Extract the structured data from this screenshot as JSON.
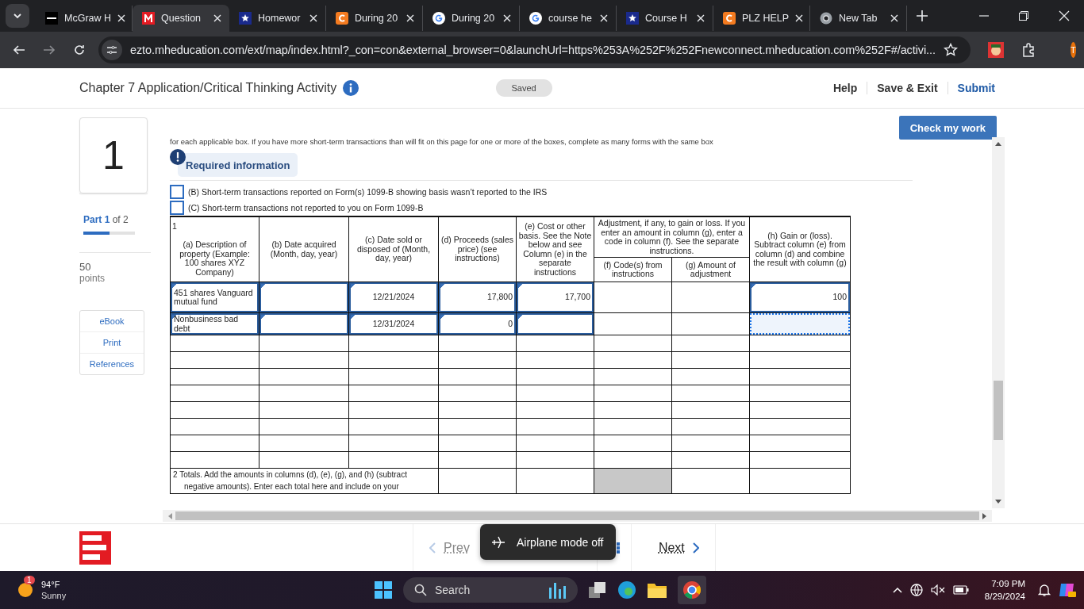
{
  "browser": {
    "tabs": [
      {
        "title": "McGraw H",
        "kind": "d2l",
        "selected": false
      },
      {
        "title": "Question",
        "kind": "mh",
        "selected": true
      },
      {
        "title": "Homewor",
        "kind": "star",
        "selected": false
      },
      {
        "title": "During 20",
        "kind": "c",
        "selected": false
      },
      {
        "title": "During 20",
        "kind": "google",
        "selected": false
      },
      {
        "title": "course he",
        "kind": "google",
        "selected": false
      },
      {
        "title": "Course H",
        "kind": "star",
        "selected": false
      },
      {
        "title": "PLZ HELP",
        "kind": "c",
        "selected": false
      },
      {
        "title": "New Tab",
        "kind": "chrome",
        "selected": false
      }
    ],
    "address": "ezto.mheducation.com/ext/map/index.html?_con=con&external_browser=0&launchUrl=https%253A%252F%252Fnewconnect.mheducation.com%252F#/activi...",
    "profile": "T"
  },
  "header": {
    "title": "Chapter 7 Application/Critical Thinking Activity",
    "status": "Saved",
    "links": [
      "Help",
      "Save & Exit",
      "Submit"
    ]
  },
  "sidebar": {
    "question_number": "1",
    "part": "**Part 1** of 2",
    "progress": {
      "level": 0.5
    },
    "points": "50",
    "points_label": "points",
    "resources": [
      "eBook",
      "Print",
      "References"
    ]
  },
  "check_button": "Check my work",
  "instructions": "for each applicable box. If you have more short-term transactions than will fit on this page for one or more of the boxes, complete as many forms with the same box",
  "required_info": "Required information",
  "checkboxes": [
    {
      "label": "(B) Short-term transactions reported on Form(s) 1099-B showing basis wasn’t reported to the IRS",
      "checked": false
    },
    {
      "label": "(C) Short-term transactions not reported to you on Form 1099-B",
      "checked": false
    }
  ],
  "table": {
    "line_number": "1",
    "columns": [
      "(a) Description of property (Example: 100 shares XYZ Company)",
      "(b) Date acquired (Month, day, year)",
      "(c) Date sold or disposed of (Month, day, year)",
      "(d) Proceeds (sales price) (see instructions)",
      "(e) Cost or other basis.  See the Note below and see Column (e) in the separate instructions",
      "(f) Code(s) from instructions",
      "(g) Amount of adjustment",
      "(h) Gain or (loss). Subtract column (e) from column (d) and combine the result with column (g)"
    ],
    "adjustment_heading": "Adjustment, if any, to gain or loss.  If you enter an amount in column (g), enter a code in column (f).  See the separate instructions.",
    "rows": [
      {
        "kind": "entry",
        "cells": [
          {
            "kind": "input",
            "value": "451 shares Vanguard mutual fund",
            "focused": false
          },
          {
            "kind": "input",
            "focused": false
          },
          {
            "kind": "input",
            "value": "12/21/2024",
            "focused": false
          },
          {
            "kind": "input",
            "value": "17,800",
            "focused": false
          },
          {
            "kind": "input",
            "value": "17,700",
            "focused": false
          },
          {
            "kind": "plain"
          },
          {
            "kind": "plain"
          },
          {
            "kind": "input",
            "value": "100",
            "focused": false
          }
        ]
      },
      {
        "kind": "entry",
        "cells": [
          {
            "kind": "input",
            "value": "Nonbusiness bad debt",
            "focused": false
          },
          {
            "kind": "input",
            "focused": false
          },
          {
            "kind": "input",
            "value": "12/31/2024",
            "focused": false
          },
          {
            "kind": "input",
            "value": "0",
            "focused": false
          },
          {
            "kind": "input",
            "focused": false
          },
          {
            "kind": "plain"
          },
          {
            "kind": "plain"
          },
          {
            "kind": "input",
            "focused": true
          }
        ]
      },
      {
        "kind": "blank"
      },
      {
        "kind": "blank"
      },
      {
        "kind": "blank"
      },
      {
        "kind": "blank"
      },
      {
        "kind": "blank"
      },
      {
        "kind": "blank"
      },
      {
        "kind": "blank"
      },
      {
        "kind": "blank"
      }
    ],
    "totals": {
      "label": "2   Totals.  Add the amounts in columns (d), (e), (g), and (h) (subtract",
      "label_cont": "negative amounts).  Enter each total here and include on your"
    }
  },
  "footer": {
    "prev": "Prev",
    "next": "Next",
    "toast": "Airplane mode off"
  },
  "taskbar": {
    "temperature": "94°F",
    "weather": "Sunny",
    "badge": "1",
    "search": "Search",
    "time": "7:09 PM",
    "date": "8/29/2024"
  }
}
